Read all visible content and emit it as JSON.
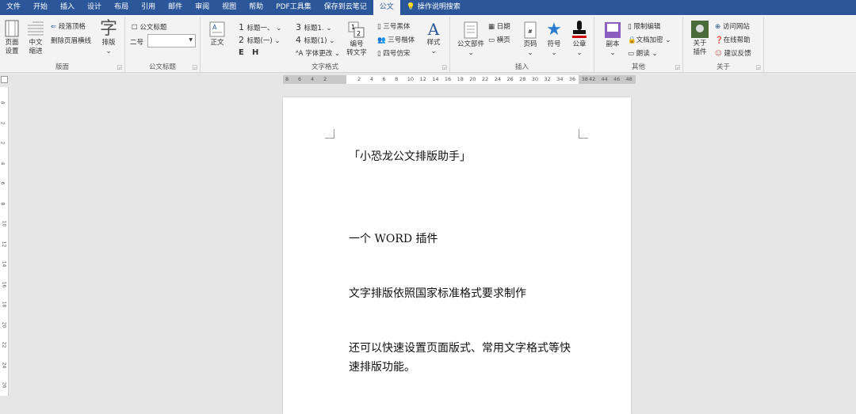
{
  "tabs": [
    "文件",
    "开始",
    "插入",
    "设计",
    "布局",
    "引用",
    "邮件",
    "审阅",
    "视图",
    "帮助",
    "PDF工具集",
    "保存到云笔记",
    "公文"
  ],
  "active_tab": "公文",
  "search": "操作说明搜索",
  "ribbon": {
    "banmian": {
      "label": "版面",
      "page_setup": "页面\n设置",
      "indent": "中文\n缩进",
      "para_top": "段落顶格",
      "del_header_line": "删除页眉横线",
      "typeset": "排版"
    },
    "title": {
      "label": "公文标题",
      "checkbox": "公文标题",
      "size_label": "二号",
      "size_value": ""
    },
    "textfmt": {
      "label": "文字格式",
      "body": "正文",
      "h1": "标题一、",
      "h2": "标题(一)",
      "h3": "标题1.",
      "h4": "标题(1)",
      "e": "E",
      "h": "H",
      "font_change": "字体更改",
      "num_to_text": "编号\n转文字",
      "hei": "三号黑体",
      "kai": "三号楷体",
      "fang": "四号仿宋",
      "style": "样式"
    },
    "insert": {
      "label": "插入",
      "parts": "公文部件",
      "date": "日期",
      "landscape": "横页",
      "page_num": "页码",
      "symbol": "符号",
      "seal": "公章"
    },
    "other": {
      "label": "其他",
      "copy": "副本",
      "restrict": "限制编辑",
      "encrypt": "文档加密",
      "read": "朗读"
    },
    "about": {
      "label": "关于",
      "about_plugin": "关于\n插件",
      "visit": "访问网站",
      "help": "在线帮助",
      "feedback": "建议反馈"
    }
  },
  "ruler": {
    "left": [
      "8",
      "6",
      "4",
      "2"
    ],
    "main": [
      "2",
      "4",
      "6",
      "8",
      "10",
      "12",
      "14",
      "16",
      "18",
      "20",
      "22",
      "24",
      "26",
      "28",
      "30",
      "32",
      "34",
      "36",
      "38"
    ],
    "right": [
      "42",
      "44",
      "46",
      "48"
    ]
  },
  "vruler": [
    "4",
    "2",
    "2",
    "4",
    "6",
    "8",
    "10",
    "12",
    "14",
    "16",
    "18",
    "20",
    "22",
    "24",
    "26"
  ],
  "document": {
    "p1": "「小恐龙公文排版助手」",
    "p2": "一个 WORD 插件",
    "p3": "文字排版依照国家标准格式要求制作",
    "p4a": "还可以快速设置页面版式、常用文字格式等快",
    "p4b": "速排版功能。"
  }
}
